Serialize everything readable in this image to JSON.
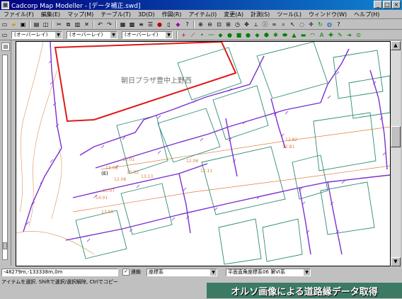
{
  "window": {
    "title": "Cadcorp Map Modeller - [データ補正.swd]",
    "controls": [
      "_",
      "□",
      "×"
    ]
  },
  "menubar": {
    "items": [
      "ファイル(F)",
      "編集(E)",
      "マップ(M)",
      "テーブル(T)",
      "3D(D)",
      "作図(R)",
      "アイテム(I)",
      "変更(A)",
      "計測(S)",
      "ツール(L)",
      "ウィンドウ(W)",
      "ヘルプ(H)"
    ]
  },
  "toolbar2": {
    "overlays": [
      "(オーバーレイ)",
      "(オーバーレイ)",
      "(オーバーレイ)"
    ]
  },
  "map": {
    "label": "朝日プラザ豊中上野西"
  },
  "status": {
    "coordinates": "-48279m,-133338m,0m",
    "snap_label": "連鎖",
    "coord_system": "座標系",
    "projection": "平面直角座標系06 第VI系"
  },
  "hint": {
    "text": "アイテムを選択. Shiftで選択/選択解除, Ctrlでコピー"
  },
  "banner": {
    "text": "オルソ画像による道路縁データ取得"
  },
  "colors": {
    "title_bar": "#000080",
    "road_edge": "#7b2fcf",
    "building": "#2e8b74",
    "highlight": "#e01818",
    "contour": "#e08040",
    "banner": "#3c7a64"
  }
}
